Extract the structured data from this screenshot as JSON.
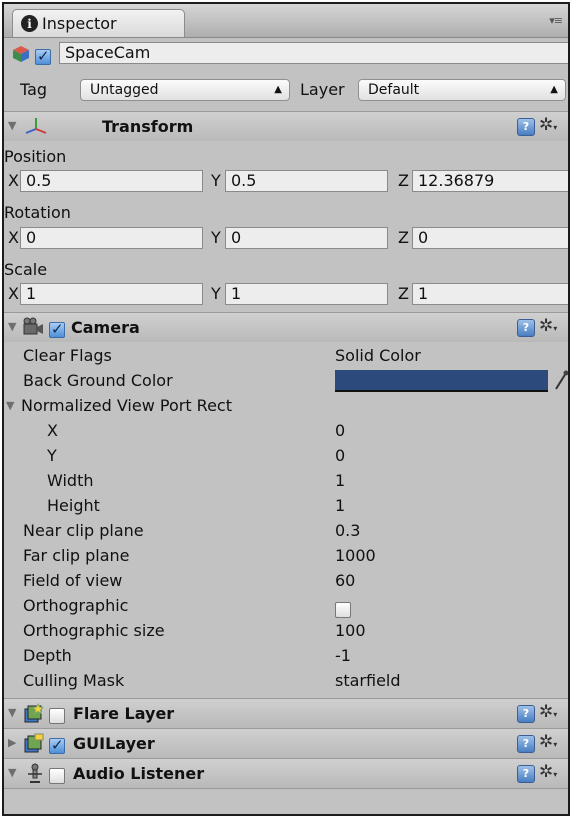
{
  "tab": {
    "title": "Inspector"
  },
  "object": {
    "name": "SpaceCam",
    "active": true,
    "tag_label": "Tag",
    "tag_value": "Untagged",
    "layer_label": "Layer",
    "layer_value": "Default"
  },
  "transform": {
    "title": "Transform",
    "position": {
      "label": "Position",
      "x": "0.5",
      "y": "0.5",
      "z": "12.36879"
    },
    "rotation": {
      "label": "Rotation",
      "x": "0",
      "y": "0",
      "z": "0"
    },
    "scale": {
      "label": "Scale",
      "x": "1",
      "y": "1",
      "z": "1"
    },
    "axis_x": "X",
    "axis_y": "Y",
    "axis_z": "Z"
  },
  "camera": {
    "title": "Camera",
    "enabled": true,
    "clear_flags": {
      "label": "Clear Flags",
      "value": "Solid Color"
    },
    "bg_color": {
      "label": "Back Ground Color",
      "color": "#2c4a7c"
    },
    "viewport": {
      "label": "Normalized View Port Rect",
      "x": {
        "label": "X",
        "value": "0"
      },
      "y": {
        "label": "Y",
        "value": "0"
      },
      "width": {
        "label": "Width",
        "value": "1"
      },
      "height": {
        "label": "Height",
        "value": "1"
      }
    },
    "near_clip": {
      "label": "Near clip plane",
      "value": "0.3"
    },
    "far_clip": {
      "label": "Far clip plane",
      "value": "1000"
    },
    "fov": {
      "label": "Field of view",
      "value": "60"
    },
    "orthographic": {
      "label": "Orthographic",
      "checked": false
    },
    "ortho_size": {
      "label": "Orthographic size",
      "value": "100"
    },
    "depth": {
      "label": "Depth",
      "value": "-1"
    },
    "culling_mask": {
      "label": "Culling Mask",
      "value": "starfield"
    }
  },
  "components": {
    "flare": {
      "title": "Flare Layer",
      "enabled": false
    },
    "gui": {
      "title": "GUILayer",
      "enabled": true
    },
    "audio": {
      "title": "Audio Listener",
      "enabled": false
    }
  },
  "colors": {
    "panel": "#c2c2c2",
    "header": "#c5c5c5",
    "accent": "#2c4a7c",
    "help": "#4a7dc1"
  },
  "icons": [
    "info-icon",
    "gameobject-cube-icon",
    "transform-axes-icon",
    "camera-icon",
    "flare-layer-icon",
    "gui-layer-icon",
    "audio-listener-icon",
    "help-icon",
    "gear-icon",
    "eyedropper-icon",
    "tab-menu-icon"
  ]
}
